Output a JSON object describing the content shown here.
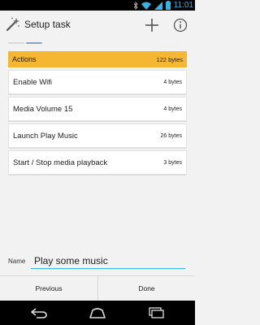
{
  "status_bar": {
    "time": "11:01"
  },
  "action_bar": {
    "title": "Setup task"
  },
  "actions_header": {
    "label": "Actions",
    "size": "122 bytes"
  },
  "actions": [
    {
      "name": "Enable Wifi",
      "bytes": "4 bytes"
    },
    {
      "name": "Media Volume 15",
      "bytes": "4 bytes"
    },
    {
      "name": "Launch Play Music",
      "bytes": "26 bytes"
    },
    {
      "name": "Start / Stop media playback",
      "bytes": "3 bytes"
    }
  ],
  "name_field": {
    "label": "Name",
    "value": "Play some music"
  },
  "buttons": {
    "previous": "Previous",
    "done": "Done"
  },
  "colors": {
    "accent": "#33b5e5",
    "header": "#f5b632"
  },
  "icons": {
    "status": [
      "bluetooth-icon",
      "wifi-icon",
      "signal-icon",
      "battery-icon"
    ],
    "action_bar": [
      "wand-icon",
      "add-icon",
      "info-icon"
    ],
    "nav": [
      "back-icon",
      "home-icon",
      "recent-apps-icon"
    ]
  }
}
